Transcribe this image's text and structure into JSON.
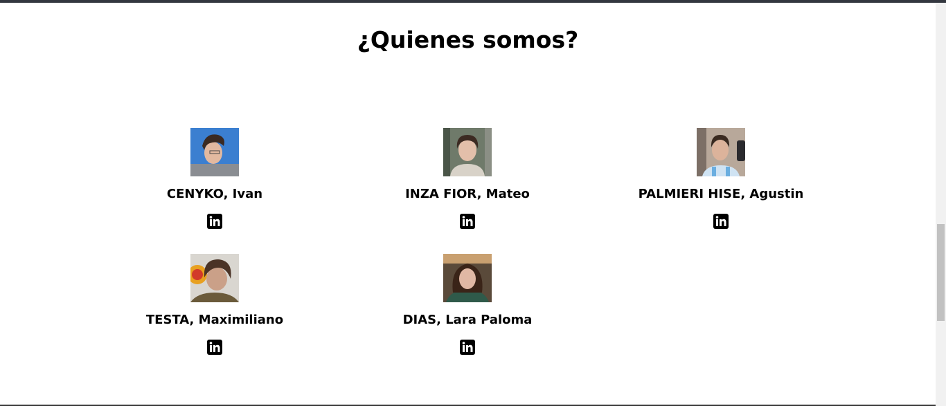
{
  "section": {
    "title": "¿Quienes somos?"
  },
  "members": [
    {
      "name": "CENYKO, Ivan",
      "photo": "profile-photo-ivan",
      "link_icon": "linkedin-icon"
    },
    {
      "name": "INZA FIOR, Mateo",
      "photo": "profile-photo-mateo",
      "link_icon": "linkedin-icon"
    },
    {
      "name": "PALMIERI HISE, Agustin",
      "photo": "profile-photo-agustin",
      "link_icon": "linkedin-icon"
    },
    {
      "name": "TESTA, Maximiliano",
      "photo": "profile-photo-maximiliano",
      "link_icon": "linkedin-icon"
    },
    {
      "name": "DIAS, Lara Paloma",
      "photo": "profile-photo-lara",
      "link_icon": "linkedin-icon"
    }
  ],
  "colors": {
    "text": "#000000",
    "background": "#ffffff",
    "linkedin_icon": "#000000"
  }
}
